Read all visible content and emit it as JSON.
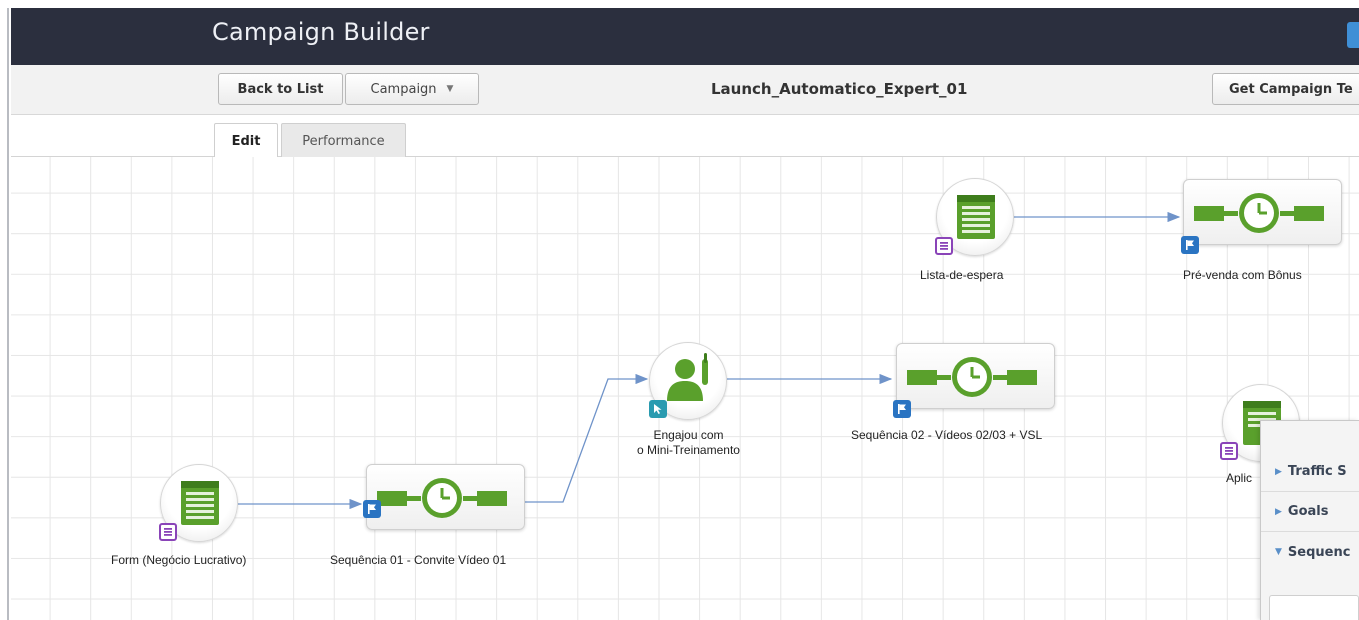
{
  "header": {
    "title": "Campaign Builder"
  },
  "toolbar": {
    "back_label": "Back to List",
    "campaign_label": "Campaign",
    "campaign_name": "Launch_Automatico_Expert_01",
    "template_label": "Get Campaign Te"
  },
  "tabs": [
    {
      "label": "Edit",
      "active": true
    },
    {
      "label": "Performance",
      "active": false
    }
  ],
  "nodes": {
    "form": {
      "label": "Form (Negócio Lucrativo)",
      "icon": "web-form-icon"
    },
    "seq1": {
      "label": "Sequência 01 - Convite Vídeo 01",
      "icon": "sequence-timer-icon"
    },
    "engaged": {
      "label_line1": "Engajou com",
      "label_line2": "o Mini-Treinamento",
      "icon": "person-goal-icon"
    },
    "seq2": {
      "label": "Sequência 02 - Vídeos 02/03 + VSL",
      "icon": "sequence-timer-icon"
    },
    "lista": {
      "label": "Lista-de-espera",
      "icon": "web-form-icon"
    },
    "prevenda": {
      "label": "Pré-venda com Bônus",
      "icon": "sequence-timer-icon"
    },
    "aplic": {
      "label": "Aplic",
      "icon": "web-form-icon"
    }
  },
  "panel": {
    "items": [
      {
        "label": "Traffic S",
        "expanded": false
      },
      {
        "label": "Goals",
        "expanded": false
      },
      {
        "label": "Sequenc",
        "expanded": true
      }
    ]
  },
  "colors": {
    "header_bg": "#2b2f3e",
    "connector": "#6f93c9",
    "green": "#5aa02c",
    "form_badge": "#8a44b8",
    "flag_badge": "#2a74c2",
    "click_badge": "#2a9bb0"
  }
}
